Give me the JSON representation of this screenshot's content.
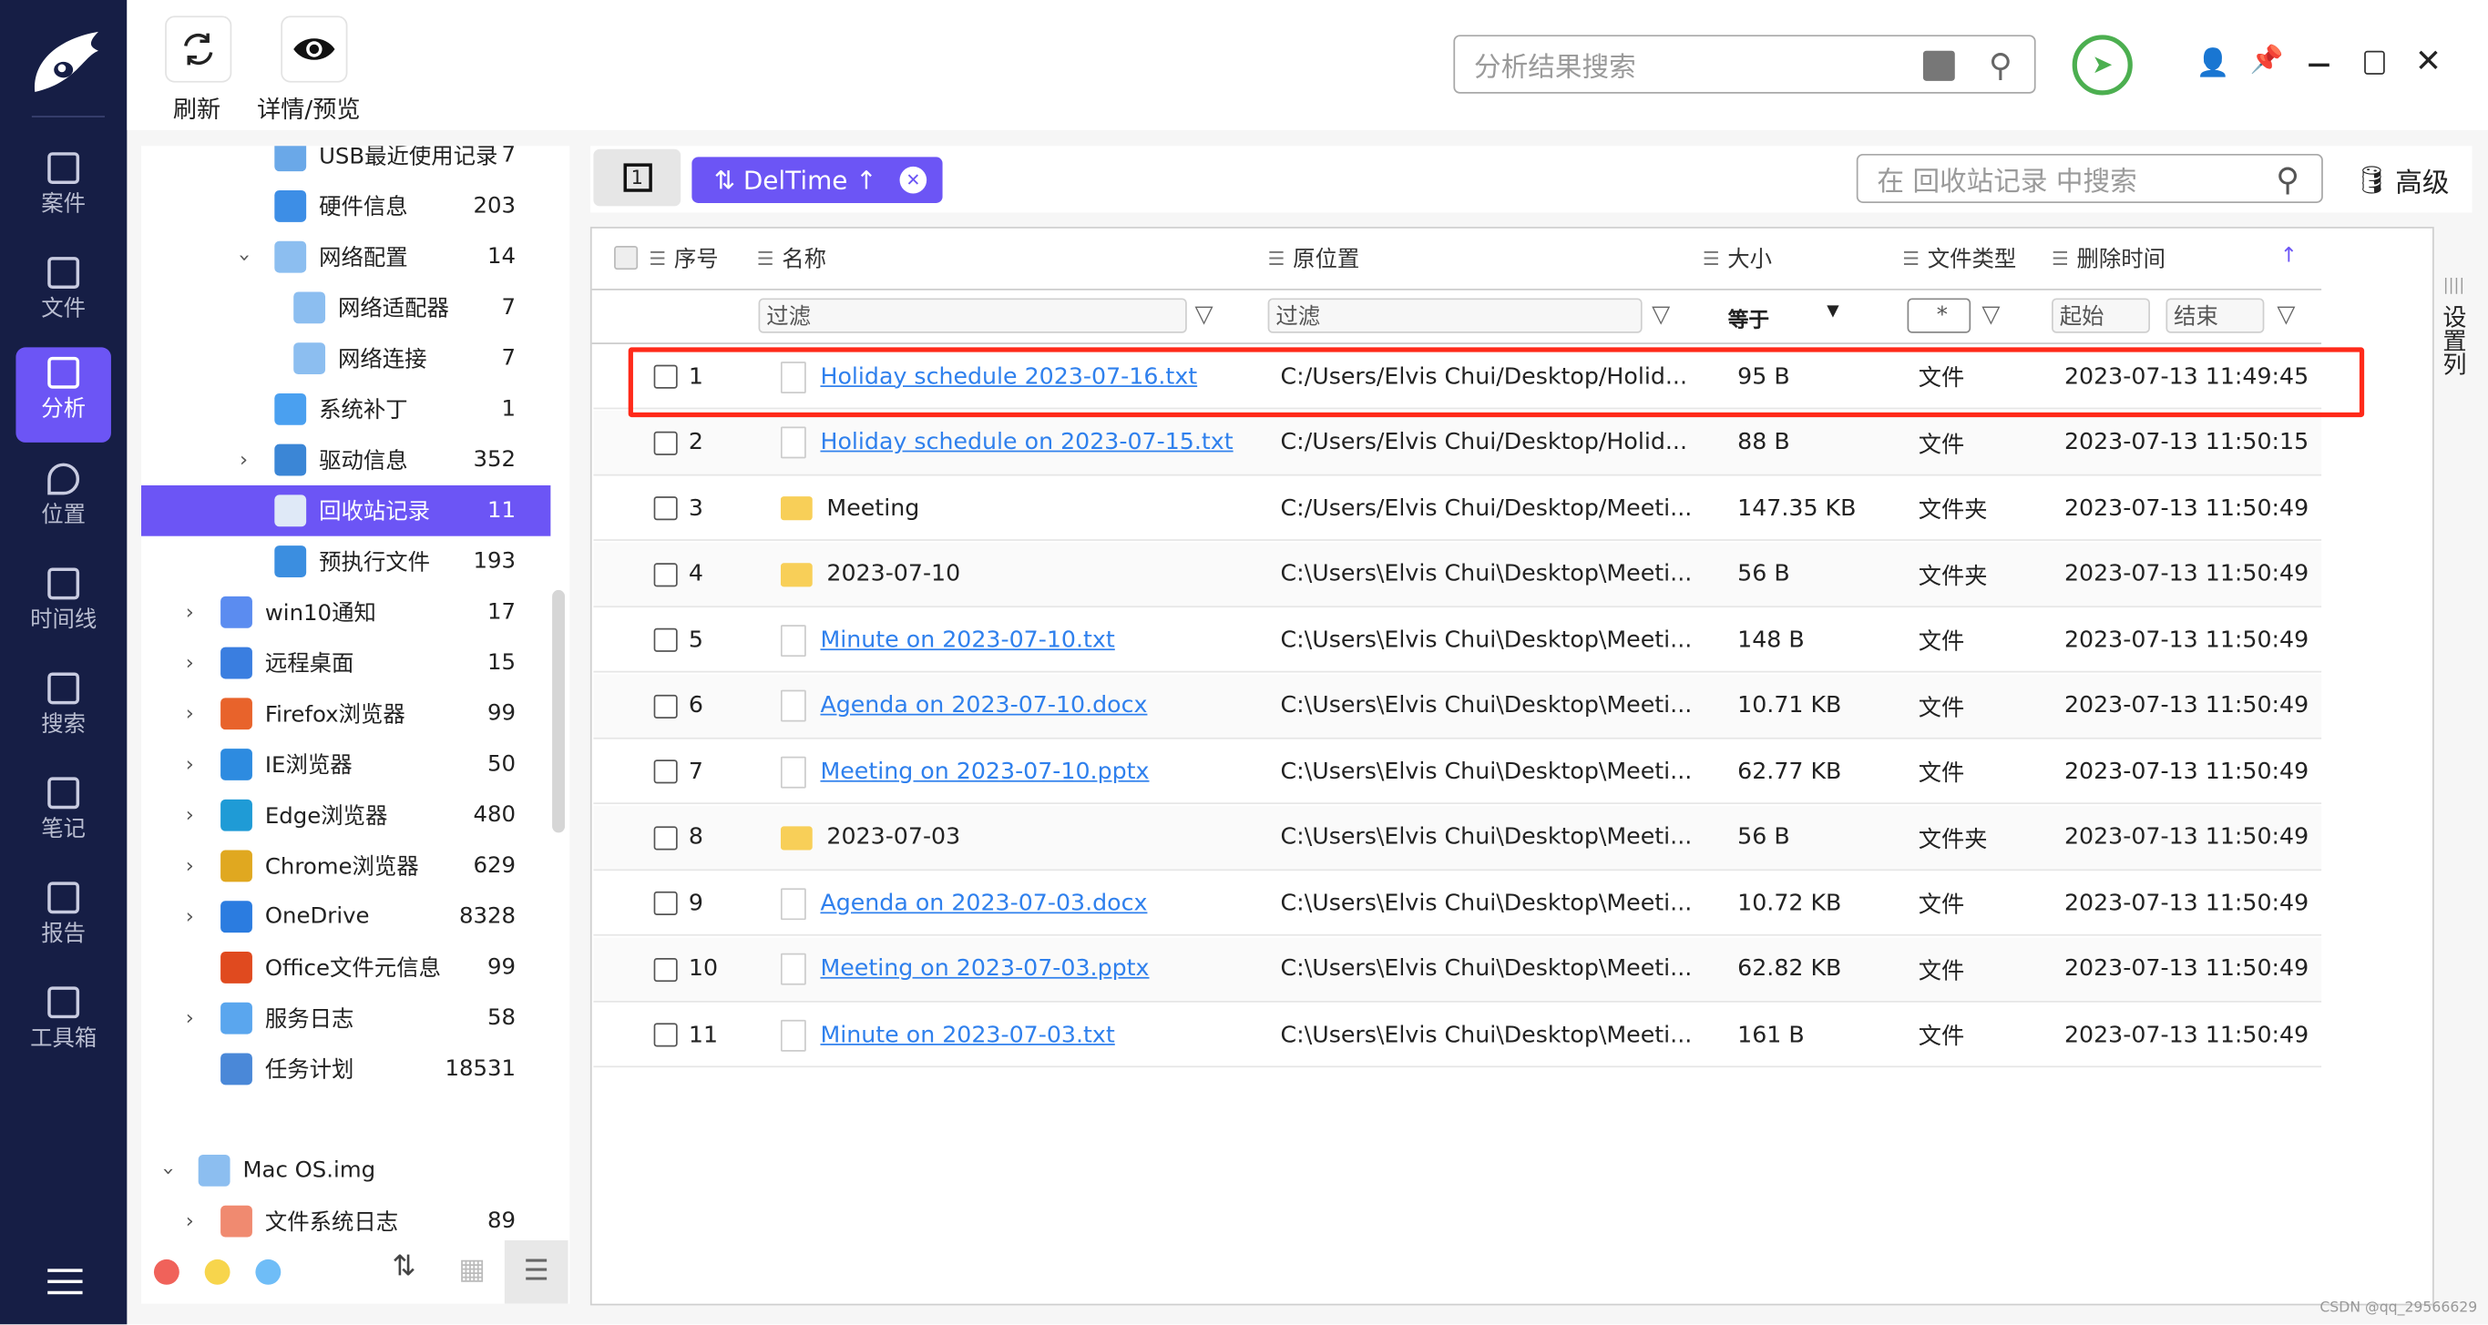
{
  "nav": {
    "items": [
      {
        "label": "案件",
        "icon": "case-icon"
      },
      {
        "label": "文件",
        "icon": "folder-icon"
      },
      {
        "label": "分析",
        "icon": "analysis-icon",
        "active": true
      },
      {
        "label": "位置",
        "icon": "location-icon"
      },
      {
        "label": "时间线",
        "icon": "timeline-icon"
      },
      {
        "label": "搜索",
        "icon": "search-icon"
      },
      {
        "label": "笔记",
        "icon": "note-icon"
      },
      {
        "label": "报告",
        "icon": "report-icon"
      },
      {
        "label": "工具箱",
        "icon": "toolbox-icon"
      }
    ]
  },
  "toolbar": {
    "refresh_label": "刷新",
    "preview_label": "详情/预览",
    "search_placeholder": "分析结果搜索"
  },
  "tree": {
    "items": [
      {
        "label": "USB最近使用记录",
        "count": "7",
        "indent": 2,
        "icon": "usb-icon",
        "color": "#6aa8e8"
      },
      {
        "label": "硬件信息",
        "count": "203",
        "indent": 2,
        "icon": "chip-icon",
        "color": "#3d8ee6"
      },
      {
        "label": "网络配置",
        "count": "14",
        "indent": 2,
        "chev": "v",
        "icon": "network-card-icon",
        "color": "#8cbef0"
      },
      {
        "label": "网络适配器",
        "count": "7",
        "indent": 3,
        "icon": "network-card-icon",
        "color": "#8cbef0"
      },
      {
        "label": "网络连接",
        "count": "7",
        "indent": 3,
        "icon": "network-card-icon",
        "color": "#8cbef0"
      },
      {
        "label": "系统补丁",
        "count": "1",
        "indent": 2,
        "icon": "patch-icon",
        "color": "#4aa0f0"
      },
      {
        "label": "驱动信息",
        "count": "352",
        "indent": 2,
        "chev": ">",
        "icon": "drive-icon",
        "color": "#3b86d6"
      },
      {
        "label": "回收站记录",
        "count": "11",
        "indent": 2,
        "icon": "recycle-bin-icon",
        "color": "#dfe9f7",
        "selected": true
      },
      {
        "label": "预执行文件",
        "count": "193",
        "indent": 2,
        "icon": "prefetch-icon",
        "color": "#3b8ee0"
      },
      {
        "label": "win10通知",
        "count": "17",
        "indent": 1,
        "chev": ">",
        "icon": "bell-icon",
        "color": "#5b8cf0"
      },
      {
        "label": "远程桌面",
        "count": "15",
        "indent": 1,
        "chev": ">",
        "icon": "remote-desktop-icon",
        "color": "#3a7ee0"
      },
      {
        "label": "Firefox浏览器",
        "count": "99",
        "indent": 1,
        "chev": ">",
        "icon": "firefox-icon",
        "color": "#e8632b"
      },
      {
        "label": "IE浏览器",
        "count": "50",
        "indent": 1,
        "chev": ">",
        "icon": "ie-icon",
        "color": "#2d8be0"
      },
      {
        "label": "Edge浏览器",
        "count": "480",
        "indent": 1,
        "chev": ">",
        "icon": "edge-icon",
        "color": "#1f9bd6"
      },
      {
        "label": "Chrome浏览器",
        "count": "629",
        "indent": 1,
        "chev": ">",
        "icon": "chrome-icon",
        "color": "#e0a820"
      },
      {
        "label": "OneDrive",
        "count": "8328",
        "indent": 1,
        "chev": ">",
        "icon": "onedrive-icon",
        "color": "#2b7ce0"
      },
      {
        "label": "Office文件元信息",
        "count": "99",
        "indent": 1,
        "icon": "office-icon",
        "color": "#e04a1f"
      },
      {
        "label": "服务日志",
        "count": "58",
        "indent": 1,
        "chev": ">",
        "icon": "service-log-icon",
        "color": "#5aa6ee"
      },
      {
        "label": "任务计划",
        "count": "18531",
        "indent": 1,
        "icon": "task-schedule-icon",
        "color": "#4a88d8"
      },
      {
        "label": "",
        "count": "",
        "indent": 0
      },
      {
        "label": "Mac OS.img",
        "count": "",
        "indent": 0,
        "chev": "v",
        "icon": "disk-image-icon",
        "color": "#8cbef0"
      },
      {
        "label": "文件系统日志",
        "count": "89",
        "indent": 1,
        "chev": ">",
        "icon": "fs-log-icon",
        "color": "#f08a70"
      }
    ],
    "footer_dots": [
      "#f0625a",
      "#f7d54c",
      "#6fbdf7"
    ]
  },
  "main": {
    "page_button": "1",
    "sort_chip": "DelTime ↑",
    "search_placeholder": "在 回收站记录 中搜索",
    "advanced_label": "高级",
    "settings_columns": "设置列",
    "columns": [
      "序号",
      "名称",
      "原位置",
      "大小",
      "文件类型",
      "删除时间"
    ],
    "filters": {
      "name": "过滤",
      "location": "过滤",
      "size_op": "等于",
      "type": "*",
      "start": "起始",
      "end": "结束"
    },
    "highlight_color": "#ff2a1a",
    "rows": [
      {
        "no": "1",
        "name": "Holiday schedule 2023-07-16.txt",
        "kind": "file",
        "location": "C:/Users/Elvis Chui/Desktop/Holid...",
        "size": "95 B",
        "type": "文件",
        "deleted": "2023-07-13 11:49:45",
        "highlighted": true
      },
      {
        "no": "2",
        "name": "Holiday schedule on 2023-07-15.txt",
        "kind": "file",
        "location": "C:/Users/Elvis Chui/Desktop/Holid...",
        "size": "88 B",
        "type": "文件",
        "deleted": "2023-07-13 11:50:15"
      },
      {
        "no": "3",
        "name": "Meeting",
        "kind": "folder",
        "location": "C:/Users/Elvis Chui/Desktop/Meeti...",
        "size": "147.35 KB",
        "type": "文件夹",
        "deleted": "2023-07-13 11:50:49"
      },
      {
        "no": "4",
        "name": "2023-07-10",
        "kind": "folder",
        "location": "C:\\Users\\Elvis Chui\\Desktop\\Meeti...",
        "size": "56 B",
        "type": "文件夹",
        "deleted": "2023-07-13 11:50:49"
      },
      {
        "no": "5",
        "name": "Minute on 2023-07-10.txt",
        "kind": "file",
        "location": "C:\\Users\\Elvis Chui\\Desktop\\Meeti...",
        "size": "148 B",
        "type": "文件",
        "deleted": "2023-07-13 11:50:49"
      },
      {
        "no": "6",
        "name": "Agenda on 2023-07-10.docx",
        "kind": "file",
        "location": "C:\\Users\\Elvis Chui\\Desktop\\Meeti...",
        "size": "10.71 KB",
        "type": "文件",
        "deleted": "2023-07-13 11:50:49"
      },
      {
        "no": "7",
        "name": "Meeting on 2023-07-10.pptx",
        "kind": "file",
        "location": "C:\\Users\\Elvis Chui\\Desktop\\Meeti...",
        "size": "62.77 KB",
        "type": "文件",
        "deleted": "2023-07-13 11:50:49"
      },
      {
        "no": "8",
        "name": "2023-07-03",
        "kind": "folder",
        "location": "C:\\Users\\Elvis Chui\\Desktop\\Meeti...",
        "size": "56 B",
        "type": "文件夹",
        "deleted": "2023-07-13 11:50:49"
      },
      {
        "no": "9",
        "name": "Agenda on 2023-07-03.docx",
        "kind": "file",
        "location": "C:\\Users\\Elvis Chui\\Desktop\\Meeti...",
        "size": "10.72 KB",
        "type": "文件",
        "deleted": "2023-07-13 11:50:49"
      },
      {
        "no": "10",
        "name": "Meeting on 2023-07-03.pptx",
        "kind": "file",
        "location": "C:\\Users\\Elvis Chui\\Desktop\\Meeti...",
        "size": "62.82 KB",
        "type": "文件",
        "deleted": "2023-07-13 11:50:49"
      },
      {
        "no": "11",
        "name": "Minute on 2023-07-03.txt",
        "kind": "file",
        "location": "C:\\Users\\Elvis Chui\\Desktop\\Meeti...",
        "size": "161 B",
        "type": "文件",
        "deleted": "2023-07-13 11:50:49"
      }
    ]
  },
  "watermark": "CSDN @qq_29566629",
  "colors": {
    "nav_bg": "#161e45",
    "accent": "#6c55f5",
    "status_ok": "#4caf50",
    "link": "#2f80ed"
  }
}
